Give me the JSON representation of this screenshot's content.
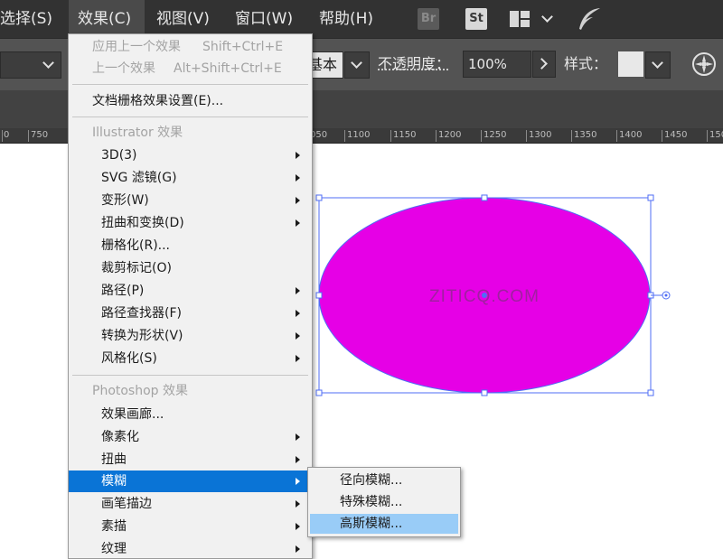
{
  "menubar": {
    "items": [
      {
        "label": "选择(S)"
      },
      {
        "label": "效果(C)"
      },
      {
        "label": "视图(V)"
      },
      {
        "label": "窗口(W)"
      },
      {
        "label": "帮助(H)"
      }
    ],
    "bridge_icon": "Br",
    "stock_icon": "St"
  },
  "controlbar": {
    "brush_value": "基本",
    "opacity_label": "不透明度：",
    "opacity_value": "100%",
    "style_label": "样式："
  },
  "ruler": {
    "labels": [
      "0",
      "750",
      "050",
      "1100",
      "1150",
      "1200",
      "1250",
      "1300",
      "1350",
      "1400",
      "1450",
      "150"
    ]
  },
  "canvas": {
    "ellipse_fill": "#e600e6",
    "selection_color": "#4f6df5",
    "watermark": "ZITICQ.COM"
  },
  "effect_menu": {
    "apply_last": {
      "label": "应用上一个效果",
      "shortcut": "Shift+Ctrl+E"
    },
    "last_effect": {
      "label": "上一个效果",
      "shortcut": "Alt+Shift+Ctrl+E"
    },
    "raster_settings": "文档栅格效果设置(E)...",
    "illustrator_header": "Illustrator 效果",
    "illustrator_items": [
      {
        "label": "3D(3)",
        "submenu": true
      },
      {
        "label": "SVG 滤镜(G)",
        "submenu": true
      },
      {
        "label": "变形(W)",
        "submenu": true
      },
      {
        "label": "扭曲和变换(D)",
        "submenu": true
      },
      {
        "label": "栅格化(R)...",
        "submenu": false
      },
      {
        "label": "裁剪标记(O)",
        "submenu": false
      },
      {
        "label": "路径(P)",
        "submenu": true
      },
      {
        "label": "路径查找器(F)",
        "submenu": true
      },
      {
        "label": "转换为形状(V)",
        "submenu": true
      },
      {
        "label": "风格化(S)",
        "submenu": true
      }
    ],
    "photoshop_header": "Photoshop 效果",
    "photoshop_items": [
      {
        "label": "效果画廊...",
        "submenu": false
      },
      {
        "label": "像素化",
        "submenu": true
      },
      {
        "label": "扭曲",
        "submenu": true
      },
      {
        "label": "模糊",
        "submenu": true
      },
      {
        "label": "画笔描边",
        "submenu": true
      },
      {
        "label": "素描",
        "submenu": true
      },
      {
        "label": "纹理",
        "submenu": true
      }
    ]
  },
  "blur_submenu": {
    "items": [
      {
        "label": "径向模糊..."
      },
      {
        "label": "特殊模糊..."
      },
      {
        "label": "高斯模糊..."
      }
    ]
  }
}
